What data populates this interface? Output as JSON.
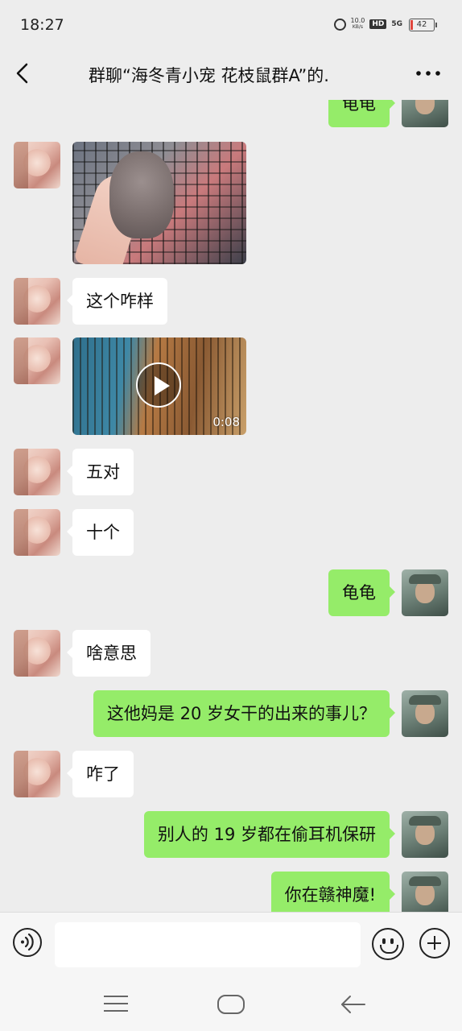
{
  "status_bar": {
    "time": "18:27",
    "net_speed_value": "10.0",
    "net_speed_unit": "KB/s",
    "hd_label": "HD",
    "network_label": "5G",
    "battery": "42"
  },
  "header": {
    "title": "群聊“海冬青小宠 花枝鼠群A”的."
  },
  "messages": [
    {
      "side": "right",
      "type": "text",
      "text": "龟龟"
    },
    {
      "side": "left",
      "type": "image"
    },
    {
      "side": "left",
      "type": "text",
      "text": "这个咋样"
    },
    {
      "side": "left",
      "type": "video",
      "duration": "0:08"
    },
    {
      "side": "left",
      "type": "text",
      "text": "五对"
    },
    {
      "side": "left",
      "type": "text",
      "text": "十个"
    },
    {
      "side": "right",
      "type": "text",
      "text": "龟龟"
    },
    {
      "side": "left",
      "type": "text",
      "text": "啥意思"
    },
    {
      "side": "right",
      "type": "text",
      "text": "这他妈是 20 岁女干的出来的事儿？"
    },
    {
      "side": "left",
      "type": "text",
      "text": "咋了"
    },
    {
      "side": "right",
      "type": "text",
      "text": "别人的 19 岁都在偷耳机保研"
    },
    {
      "side": "right",
      "type": "text",
      "text": "你在赣神魔!"
    }
  ],
  "input_bar": {
    "placeholder": "",
    "icons": [
      "voice-icon",
      "emoji-icon",
      "plus-icon"
    ]
  },
  "colors": {
    "sent_bubble": "#95ec69",
    "received_bubble": "#ffffff",
    "background": "#ededed"
  }
}
